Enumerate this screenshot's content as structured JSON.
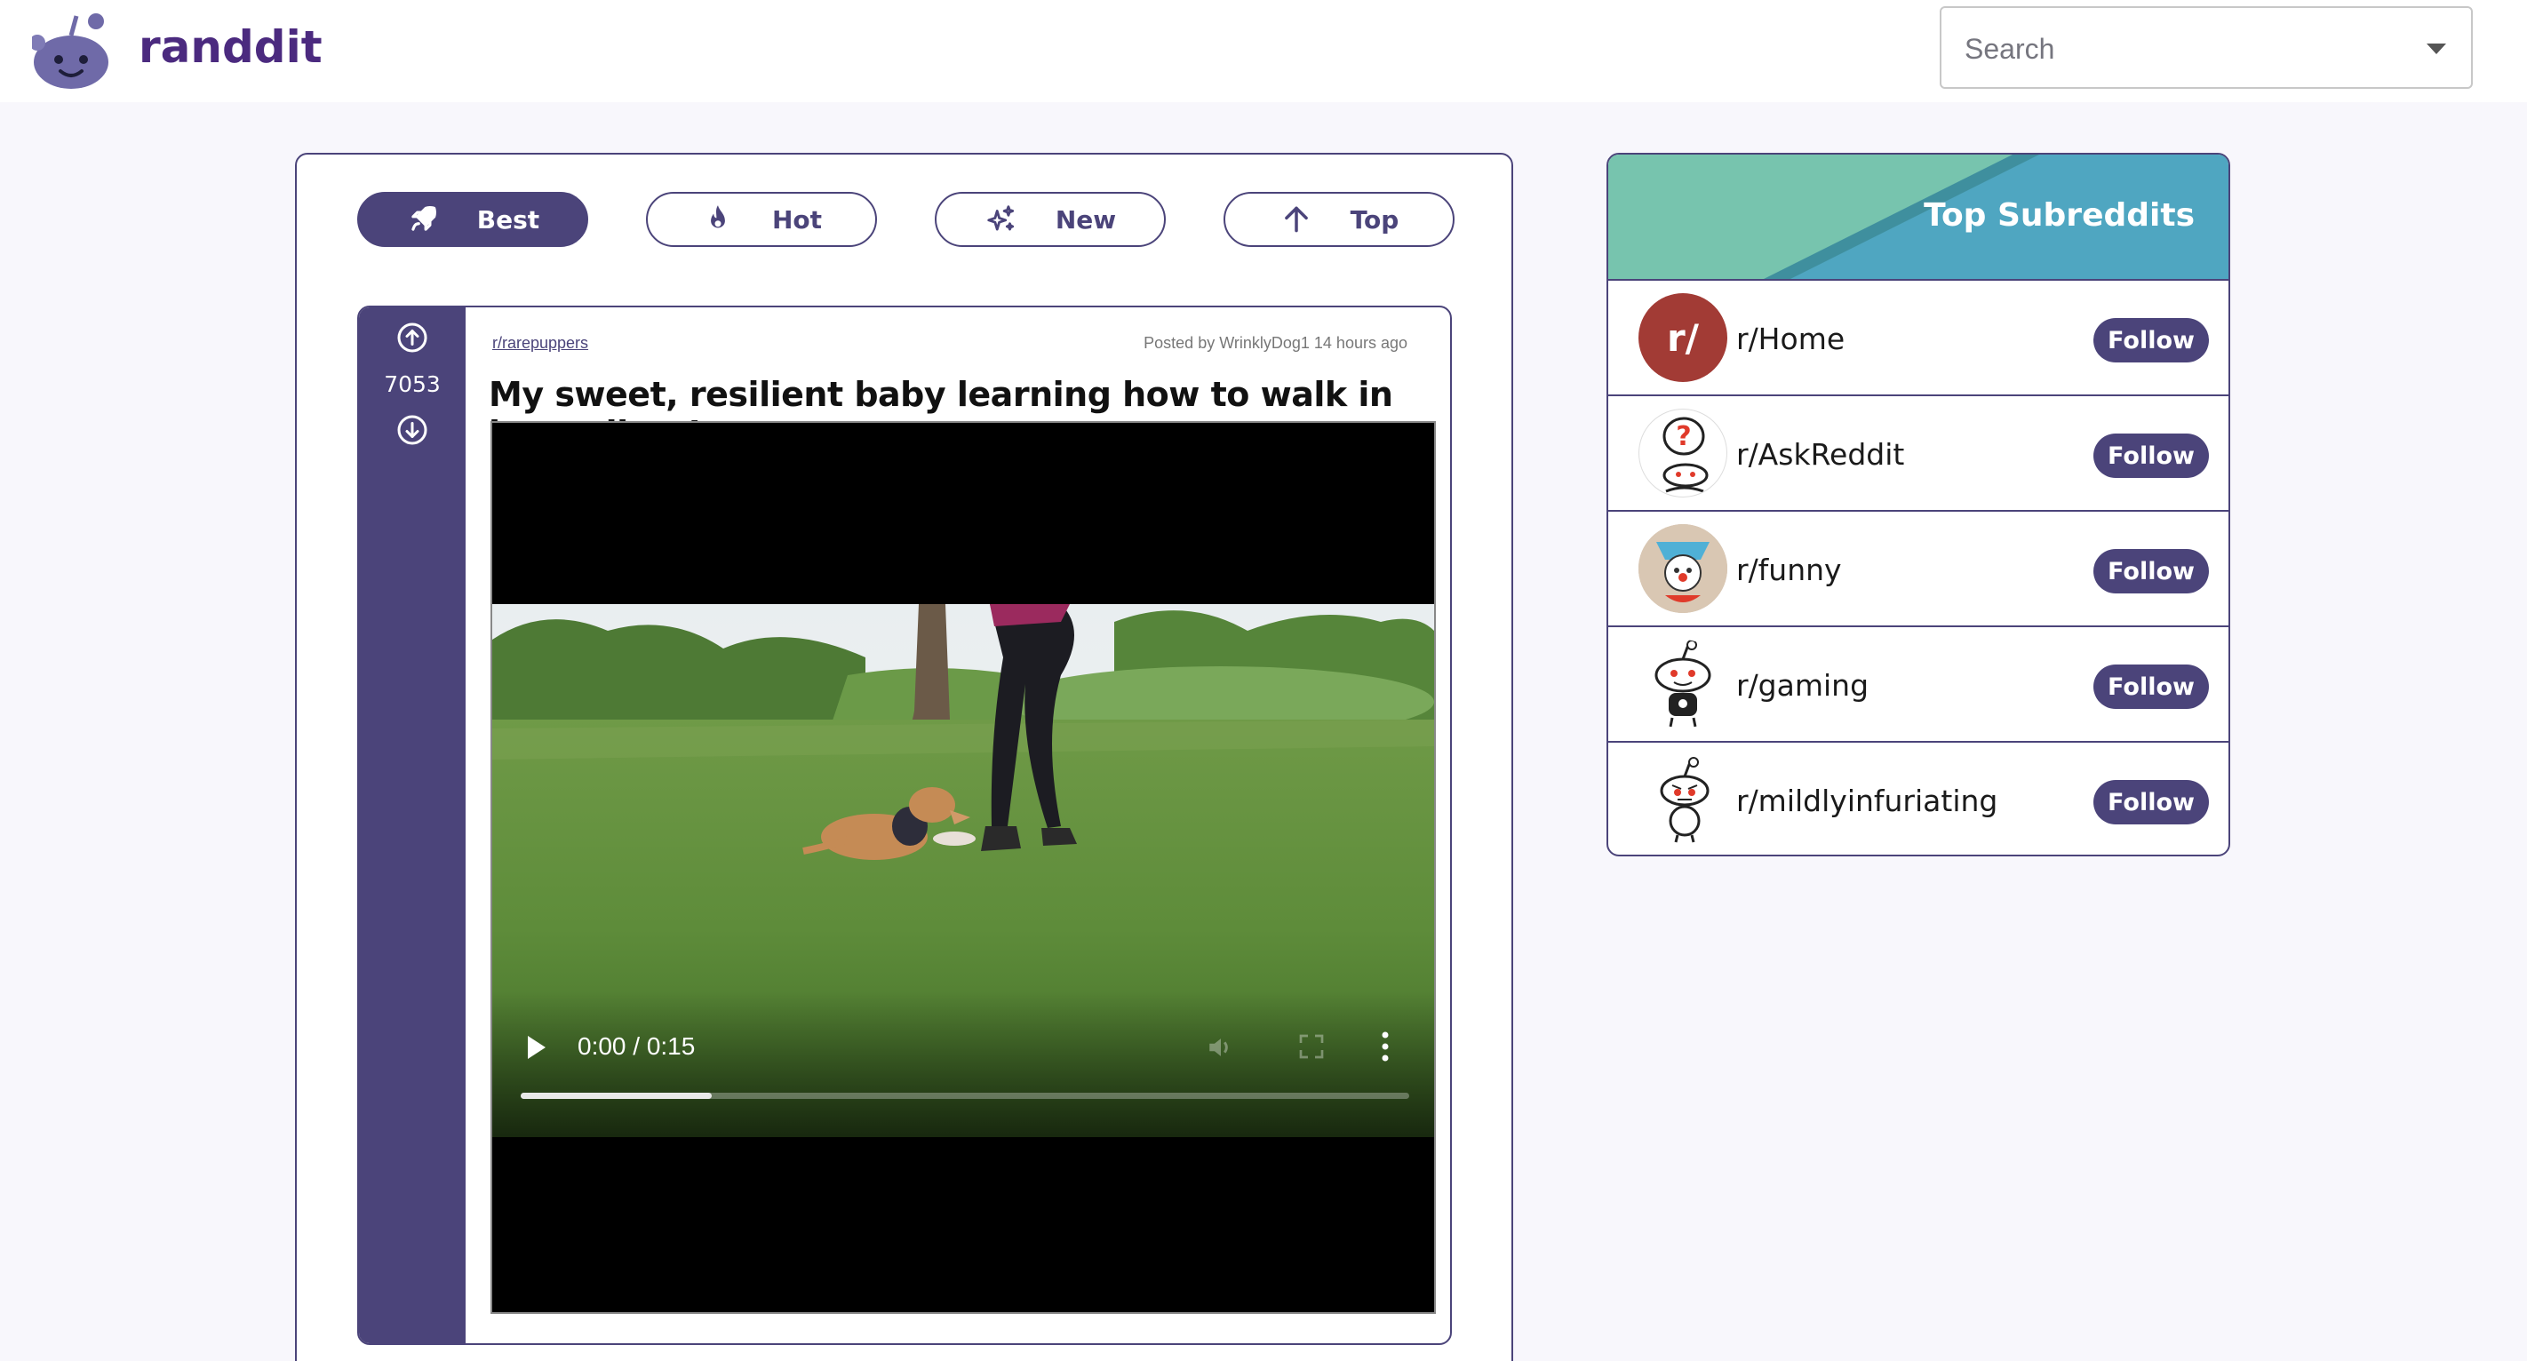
{
  "header": {
    "brand": "randdit",
    "search_placeholder": "Search"
  },
  "sort_tabs": [
    {
      "label": "Best",
      "icon": "rocket-icon",
      "active": true
    },
    {
      "label": "Hot",
      "icon": "flame-icon",
      "active": false
    },
    {
      "label": "New",
      "icon": "sparkles-icon",
      "active": false
    },
    {
      "label": "Top",
      "icon": "arrow-up-icon",
      "active": false
    }
  ],
  "post": {
    "subreddit": "r/rarepuppers",
    "meta": "Posted by WrinklyDog1 14 hours ago",
    "title": "My sweet, resilient baby learning how to walk in her splints!",
    "votes": "7053",
    "video": {
      "time": "0:00 / 0:15",
      "progress": 0.215
    }
  },
  "top_subreddits": {
    "title": "Top Subreddits",
    "items": [
      {
        "name": "r/Home",
        "button": "Follow",
        "avatar_text": "r/"
      },
      {
        "name": "r/AskReddit",
        "button": "Follow"
      },
      {
        "name": "r/funny",
        "button": "Follow"
      },
      {
        "name": "r/gaming",
        "button": "Follow"
      },
      {
        "name": "r/mildlyinfuriating",
        "button": "Follow"
      }
    ]
  },
  "colors": {
    "accent": "#4b447a",
    "brand_text": "#4b2a7f",
    "banner_teal": "#77c4ae",
    "banner_blue": "#4fa6c1",
    "home_avatar": "#a23b35"
  }
}
